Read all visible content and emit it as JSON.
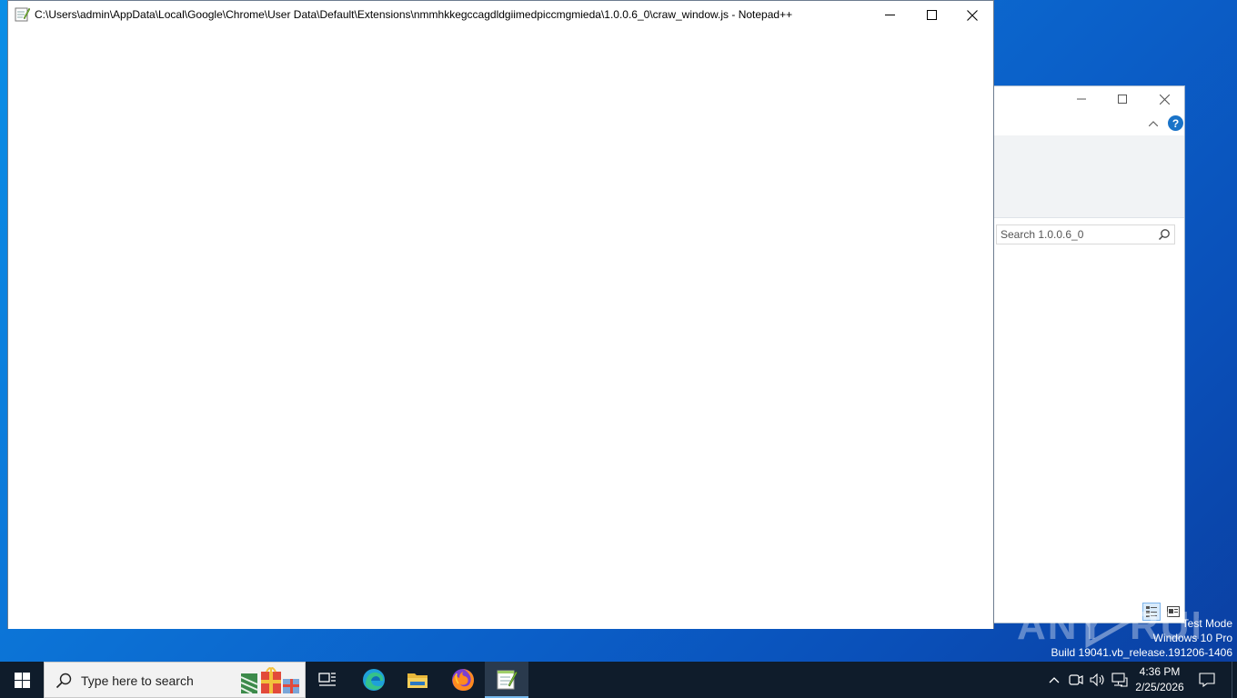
{
  "notepad": {
    "title": "C:\\Users\\admin\\AppData\\Local\\Google\\Chrome\\User Data\\Default\\Extensions\\nmmhkkegccagdldgiimedpiccmgmieda\\1.0.0.6_0\\craw_window.js - Notepad++",
    "buttons": {
      "minimize": "minimize-icon",
      "maximize": "maximize-icon",
      "close": "close-icon"
    }
  },
  "explorer": {
    "search_placeholder": "Search 1.0.0.6_0",
    "help_label": "?"
  },
  "watermark": {
    "text": "ANY RUN"
  },
  "system_info": {
    "line1": "Test Mode",
    "line2": "Windows 10 Pro",
    "line3": "Build 19041.vb_release.191206-1406"
  },
  "taskbar": {
    "search_placeholder": "Type here to search",
    "apps": [
      "task-view-icon",
      "edge-icon",
      "file-explorer-icon",
      "firefox-icon",
      "notepad-plus-plus-icon"
    ],
    "time": "4:36 PM",
    "date": "2/25/2026"
  },
  "colors": {
    "desktop": "#0a6fd3",
    "taskbar": "#0f1c2b",
    "active_indicator": "#76b9ed"
  }
}
